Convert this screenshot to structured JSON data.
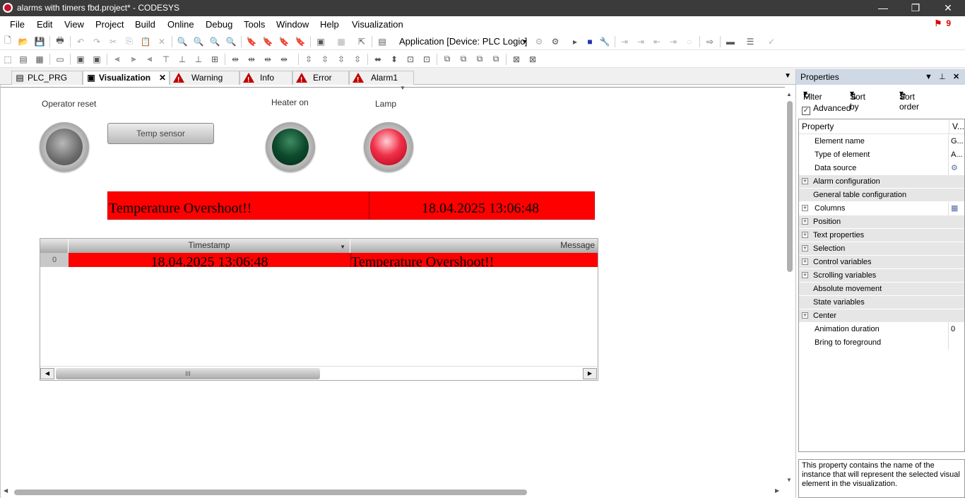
{
  "window": {
    "title": "alarms with timers fbd.project* - CODESYS",
    "controls": {
      "minimize": "—",
      "restore": "❐",
      "close": "✕"
    }
  },
  "menu": {
    "items": [
      "File",
      "Edit",
      "View",
      "Project",
      "Build",
      "Online",
      "Debug",
      "Tools",
      "Window",
      "Help",
      "Visualization"
    ],
    "alarm_count": "9"
  },
  "toolbar": {
    "application_selector": "Application [Device: PLC Logic]"
  },
  "tabs": [
    {
      "label": "PLC_PRG",
      "icon": "program-icon",
      "active": false
    },
    {
      "label": "Visualization",
      "icon": "visualization-icon",
      "active": true
    },
    {
      "label": "Warning",
      "icon": "warning-icon",
      "active": false
    },
    {
      "label": "Info",
      "icon": "warning-icon",
      "active": false
    },
    {
      "label": "Error",
      "icon": "warning-icon",
      "active": false
    },
    {
      "label": "Alarm1",
      "icon": "warning-icon",
      "active": false
    }
  ],
  "visu": {
    "operator_reset_label": "Operator reset",
    "temp_sensor_button": "Temp sensor",
    "heater_label": "Heater on",
    "lamp_label": "Lamp",
    "banner": {
      "message": "Temperature Overshoot!!",
      "timestamp": "18.04.2025 13:06:48"
    },
    "alarm_table": {
      "columns": [
        "",
        "Timestamp",
        "Message"
      ],
      "rows": [
        {
          "index": "0",
          "timestamp": "18.04.2025 13:06:48",
          "message": "Temperature Overshoot!!"
        }
      ],
      "scroll_thumb_glyph": "III"
    }
  },
  "properties": {
    "title": "Properties",
    "filter_label": "Filter",
    "sort_by_label": "Sort by",
    "sort_order_label": "Sort order",
    "advanced_label": "Advanced",
    "advanced_checked": true,
    "header": {
      "property": "Property",
      "value": "V..."
    },
    "rows": [
      {
        "name": "Element name",
        "value": "G...",
        "category": false,
        "expandable": false
      },
      {
        "name": "Type of element",
        "value": "A...",
        "category": false,
        "expandable": false
      },
      {
        "name": "Data source",
        "value": "",
        "category": false,
        "expandable": false
      },
      {
        "name": "Alarm configuration",
        "value": "",
        "category": true,
        "expandable": true
      },
      {
        "name": "General table configuration",
        "value": "",
        "category": true,
        "expandable": false
      },
      {
        "name": "Columns",
        "value": "",
        "category": false,
        "expandable": true
      },
      {
        "name": "Position",
        "value": "",
        "category": true,
        "expandable": true
      },
      {
        "name": "Text properties",
        "value": "",
        "category": true,
        "expandable": true
      },
      {
        "name": "Selection",
        "value": "",
        "category": true,
        "expandable": true
      },
      {
        "name": "Control variables",
        "value": "",
        "category": true,
        "expandable": true
      },
      {
        "name": "Scrolling variables",
        "value": "",
        "category": true,
        "expandable": true
      },
      {
        "name": "Absolute movement",
        "value": "",
        "category": true,
        "expandable": false
      },
      {
        "name": "State variables",
        "value": "",
        "category": true,
        "expandable": false
      },
      {
        "name": "Center",
        "value": "",
        "category": true,
        "expandable": true
      },
      {
        "name": "Animation duration",
        "value": "0",
        "category": false,
        "expandable": false
      },
      {
        "name": "Bring to foreground",
        "value": "",
        "category": false,
        "expandable": false
      }
    ],
    "description": "This property contains the name of the instance that will represent the selected visual element in the visualization."
  },
  "colors": {
    "alarm_red": "#ff0000",
    "title_bar": "#3b3b3b",
    "panel_header": "#cfd8e5"
  }
}
